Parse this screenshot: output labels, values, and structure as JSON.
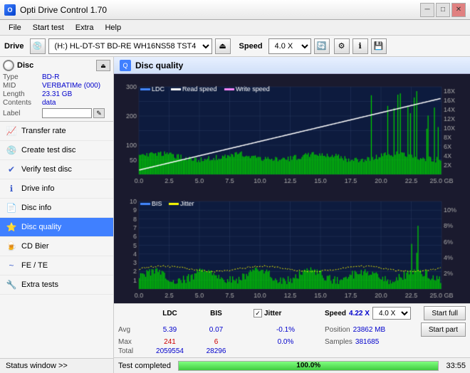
{
  "app": {
    "title": "Opti Drive Control 1.70",
    "icon": "O"
  },
  "titlebar": {
    "minimize": "─",
    "maximize": "□",
    "close": "✕"
  },
  "menubar": {
    "items": [
      "File",
      "Start test",
      "Extra",
      "Help"
    ]
  },
  "drive_toolbar": {
    "drive_label": "Drive",
    "drive_value": "(H:)  HL-DT-ST BD-RE  WH16NS58 TST4",
    "speed_label": "Speed",
    "speed_value": "4.0 X"
  },
  "disc_panel": {
    "title": "Disc",
    "rows": [
      {
        "key": "Type",
        "val": "BD-R",
        "blue": true
      },
      {
        "key": "MID",
        "val": "VERBATIMe (000)",
        "blue": true
      },
      {
        "key": "Length",
        "val": "23.31 GB",
        "blue": true
      },
      {
        "key": "Contents",
        "val": "data",
        "blue": true
      },
      {
        "key": "Label",
        "val": "",
        "blue": false
      }
    ]
  },
  "nav": {
    "items": [
      {
        "id": "transfer-rate",
        "label": "Transfer rate",
        "icon": "📈",
        "active": false
      },
      {
        "id": "create-test-disc",
        "label": "Create test disc",
        "icon": "💿",
        "active": false
      },
      {
        "id": "verify-test-disc",
        "label": "Verify test disc",
        "icon": "✔",
        "active": false
      },
      {
        "id": "drive-info",
        "label": "Drive info",
        "icon": "ℹ",
        "active": false
      },
      {
        "id": "disc-info",
        "label": "Disc info",
        "icon": "📄",
        "active": false
      },
      {
        "id": "disc-quality",
        "label": "Disc quality",
        "icon": "⭐",
        "active": true
      },
      {
        "id": "cd-bier",
        "label": "CD Bier",
        "icon": "🍺",
        "active": false
      },
      {
        "id": "fe-te",
        "label": "FE / TE",
        "icon": "~",
        "active": false
      },
      {
        "id": "extra-tests",
        "label": "Extra tests",
        "icon": "🔧",
        "active": false
      }
    ]
  },
  "sidebar_status": {
    "label": "Status window >>"
  },
  "disc_quality": {
    "title": "Disc quality",
    "legend": {
      "ldc": "LDC",
      "read_speed": "Read speed",
      "write_speed": "Write speed",
      "bis": "BIS",
      "jitter": "Jitter"
    }
  },
  "chart1": {
    "y_max": 300,
    "y_labels": [
      "300",
      "200",
      "100",
      "50"
    ],
    "y_right_labels": [
      "18X",
      "16X",
      "14X",
      "12X",
      "10X",
      "8X",
      "6X",
      "4X",
      "2X"
    ],
    "x_labels": [
      "0.0",
      "2.5",
      "5.0",
      "7.5",
      "10.0",
      "12.5",
      "15.0",
      "17.5",
      "20.0",
      "22.5",
      "25.0 GB"
    ]
  },
  "chart2": {
    "y_labels": [
      "10",
      "9",
      "8",
      "7",
      "6",
      "5",
      "4",
      "3",
      "2",
      "1"
    ],
    "y_right_labels": [
      "10%",
      "8%",
      "6%",
      "4%",
      "2%"
    ],
    "x_labels": [
      "0.0",
      "2.5",
      "5.0",
      "7.5",
      "10.0",
      "12.5",
      "15.0",
      "17.5",
      "20.0",
      "22.5",
      "25.0 GB"
    ]
  },
  "stats": {
    "headers": [
      "LDC",
      "BIS",
      "",
      "Jitter",
      "Speed",
      ""
    ],
    "avg_label": "Avg",
    "avg_ldc": "5.39",
    "avg_bis": "0.07",
    "avg_jitter": "-0.1%",
    "max_label": "Max",
    "max_ldc": "241",
    "max_bis": "6",
    "max_jitter": "0.0%",
    "total_label": "Total",
    "total_ldc": "2059554",
    "total_bis": "28296",
    "jitter_checked": true,
    "jitter_label": "Jitter",
    "speed_val": "4.22 X",
    "speed_option": "4.0 X",
    "position_label": "Position",
    "position_val": "23862 MB",
    "samples_label": "Samples",
    "samples_val": "381685",
    "start_full_btn": "Start full",
    "start_part_btn": "Start part"
  },
  "bottom_bar": {
    "progress_pct": "100.0%",
    "time": "33:55",
    "status": "Test completed"
  }
}
